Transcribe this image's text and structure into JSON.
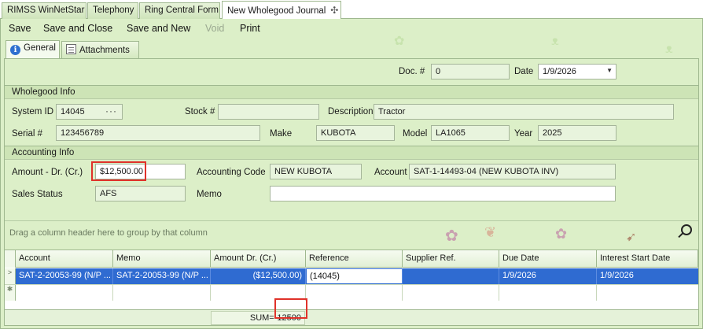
{
  "doc_tabs": [
    {
      "label": "RIMSS WinNetStar"
    },
    {
      "label": "Telephony"
    },
    {
      "label": "Ring Central Form"
    },
    {
      "label": "New Wholegood Journal",
      "active": true
    }
  ],
  "toolbar": {
    "save": "Save",
    "save_close": "Save and Close",
    "save_new": "Save and New",
    "void": "Void",
    "print": "Print"
  },
  "sub_tabs": {
    "general": "General",
    "attachments": "Attachments"
  },
  "header": {
    "doc_label": "Doc. #",
    "doc_value": "0",
    "date_label": "Date",
    "date_value": "1/9/2026"
  },
  "wholegood": {
    "title": "Wholegood Info",
    "system_id_label": "System ID",
    "system_id_value": "14045",
    "stock_label": "Stock #",
    "stock_value": "",
    "description_label": "Description",
    "description_value": "Tractor",
    "serial_label": "Serial #",
    "serial_value": "123456789",
    "make_label": "Make",
    "make_value": "KUBOTA",
    "model_label": "Model",
    "model_value": "LA1065",
    "year_label": "Year",
    "year_value": "2025"
  },
  "accounting": {
    "title": "Accounting Info",
    "amount_label": "Amount - Dr. (Cr.)",
    "amount_value": "$12,500.00",
    "code_label": "Accounting Code",
    "code_value": "NEW KUBOTA",
    "account_label": "Account",
    "account_value": "SAT-1-14493-04 (NEW KUBOTA INV)",
    "status_label": "Sales Status",
    "status_value": "AFS",
    "memo_label": "Memo",
    "memo_value": ""
  },
  "grid": {
    "group_hint": "Drag a column header here to group by that column",
    "columns": [
      "Account",
      "Memo",
      "Amount Dr. (Cr.)",
      "Reference",
      "Supplier Ref.",
      "Due Date",
      "Interest Start Date"
    ],
    "rows": [
      {
        "account": "SAT-2-20053-99 (N/P ...",
        "memo": "SAT-2-20053-99 (N/P ...",
        "amount": "($12,500.00)",
        "reference": "(14045)",
        "supplier_ref": "",
        "due_date": "1/9/2026",
        "interest_start": "1/9/2026"
      }
    ],
    "sum_label": "SUM=",
    "sum_value": "-12500"
  },
  "colors": {
    "panel_bg": "#dcefc8",
    "selection": "#2f6bd1",
    "highlight": "#e0322a"
  }
}
